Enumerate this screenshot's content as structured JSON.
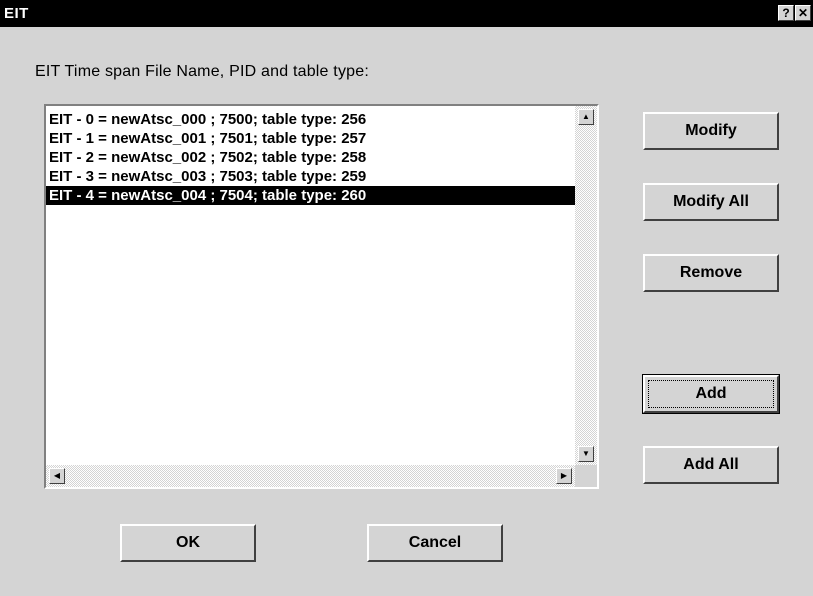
{
  "window": {
    "title": "EIT",
    "help_label": "?",
    "close_label": "✕"
  },
  "prompt": "EIT Time span File Name, PID and table type:",
  "list": {
    "items": [
      {
        "label": "EIT - 0 = newAtsc_000 ; 7500; table type: 256"
      },
      {
        "label": "EIT - 1 = newAtsc_001 ; 7501; table type: 257"
      },
      {
        "label": "EIT - 2 = newAtsc_002 ; 7502; table type: 258"
      },
      {
        "label": "EIT - 3 = newAtsc_003 ; 7503; table type: 259"
      },
      {
        "label": "EIT - 4 = newAtsc_004 ; 7504; table type: 260"
      }
    ],
    "selected_index": 4,
    "scroll_up_glyph": "▲",
    "scroll_down_glyph": "▼",
    "scroll_left_glyph": "◀",
    "scroll_right_glyph": "▶"
  },
  "buttons": {
    "modify": "Modify",
    "modify_all": "Modify All",
    "remove": "Remove",
    "add": "Add",
    "add_all": "Add All",
    "ok": "OK",
    "cancel": "Cancel"
  },
  "colors": {
    "face": "#d4d4d4",
    "selection_bg": "#000000",
    "selection_fg": "#ffffff"
  }
}
